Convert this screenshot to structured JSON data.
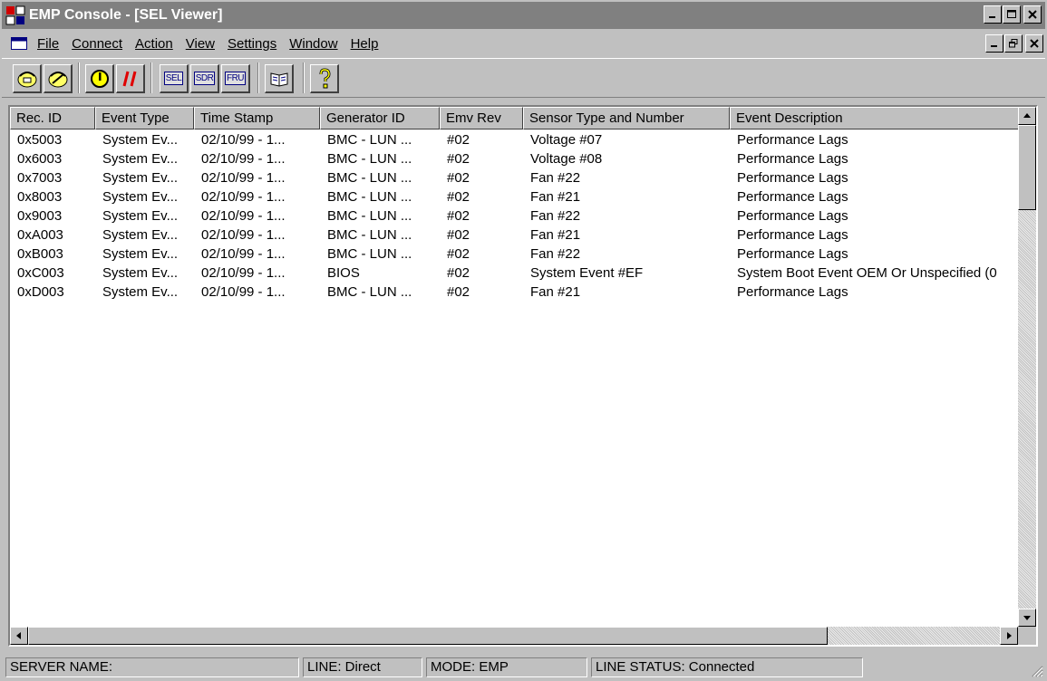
{
  "window": {
    "title": "EMP Console - [SEL Viewer]"
  },
  "menu": {
    "items": [
      {
        "label": "File"
      },
      {
        "label": "Connect"
      },
      {
        "label": "Action"
      },
      {
        "label": "View"
      },
      {
        "label": "Settings"
      },
      {
        "label": "Window"
      },
      {
        "label": "Help"
      }
    ]
  },
  "toolbar": {
    "sel_label": "SEL",
    "sdr_label": "SDR",
    "fru_label": "FRU"
  },
  "table": {
    "columns": [
      "Rec. ID",
      "Event Type",
      "Time Stamp",
      "Generator ID",
      "Emv Rev",
      "Sensor Type and Number",
      "Event Description"
    ],
    "rows": [
      [
        "0x5003",
        "System Ev...",
        "02/10/99 - 1...",
        "BMC - LUN ...",
        "#02",
        "Voltage #07",
        "Performance Lags"
      ],
      [
        "0x6003",
        "System Ev...",
        "02/10/99 - 1...",
        "BMC - LUN ...",
        "#02",
        "Voltage #08",
        "Performance Lags"
      ],
      [
        "0x7003",
        "System Ev...",
        "02/10/99 - 1...",
        "BMC - LUN ...",
        "#02",
        "Fan #22",
        "Performance Lags"
      ],
      [
        "0x8003",
        "System Ev...",
        "02/10/99 - 1...",
        "BMC - LUN ...",
        "#02",
        "Fan #21",
        "Performance Lags"
      ],
      [
        "0x9003",
        "System Ev...",
        "02/10/99 - 1...",
        "BMC - LUN ...",
        "#02",
        "Fan #22",
        "Performance Lags"
      ],
      [
        "0xA003",
        "System Ev...",
        "02/10/99 - 1...",
        "BMC - LUN ...",
        "#02",
        "Fan #21",
        "Performance Lags"
      ],
      [
        "0xB003",
        "System Ev...",
        "02/10/99 - 1...",
        "BMC - LUN ...",
        "#02",
        "Fan #22",
        "Performance Lags"
      ],
      [
        "0xC003",
        "System Ev...",
        "02/10/99 - 1...",
        "BIOS",
        "#02",
        "System Event #EF",
        "System Boot Event OEM Or Unspecified (0"
      ],
      [
        "0xD003",
        "System Ev...",
        "02/10/99 - 1...",
        "BMC - LUN ...",
        "#02",
        "Fan #21",
        "Performance Lags"
      ]
    ]
  },
  "status": {
    "server_name": "SERVER NAME:",
    "line": "LINE: Direct",
    "mode": "MODE: EMP",
    "line_status": "LINE STATUS: Connected"
  },
  "colors": {
    "titlebar_inactive": "#808080",
    "face": "#c0c0c0",
    "window_bg": "#ffffff"
  }
}
